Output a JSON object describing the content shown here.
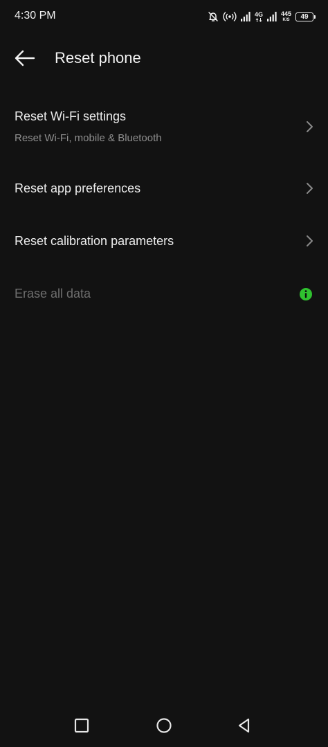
{
  "status_bar": {
    "time": "4:30 PM",
    "network_type": "4G",
    "speed_value": "445",
    "speed_unit": "K/S",
    "battery_level": "49",
    "icons": [
      "bell-off-icon",
      "hotspot-icon",
      "signal-icon",
      "signal-4g-icon",
      "battery-icon"
    ]
  },
  "app_bar": {
    "back_icon": "arrow-left-icon",
    "title": "Reset phone"
  },
  "list": {
    "items": [
      {
        "title": "Reset Wi-Fi settings",
        "subtitle": "Reset Wi-Fi, mobile & Bluetooth",
        "icon": "chevron-right-icon"
      },
      {
        "title": "Reset app preferences",
        "icon": "chevron-right-icon"
      },
      {
        "title": "Reset calibration parameters",
        "icon": "chevron-right-icon"
      },
      {
        "title": "Erase all data",
        "disabled": true,
        "icon": "info-icon"
      }
    ]
  },
  "nav_bar": {
    "icons": [
      "recents-square-icon",
      "home-circle-icon",
      "back-triangle-icon"
    ]
  },
  "colors": {
    "background": "#121212",
    "text_primary": "#EDEDED",
    "text_secondary": "#8E8E8E",
    "text_disabled": "#6F6F6F",
    "info_badge": "#2FC12F"
  }
}
